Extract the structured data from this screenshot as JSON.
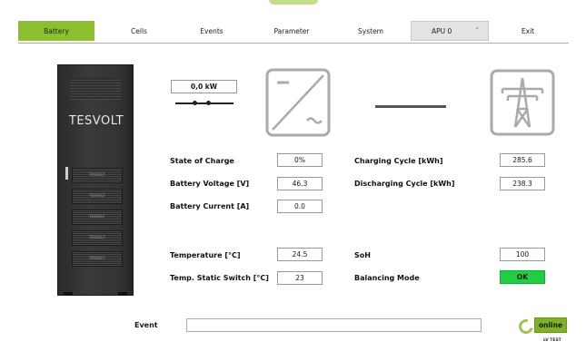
{
  "tabs": {
    "battery": "Battery",
    "cells": "Cells",
    "events": "Events",
    "parameter": "Parameter",
    "system": "System",
    "apu": "APU 0",
    "exit": "Exit"
  },
  "cabinet": {
    "logo": "TESVOLT",
    "module_label": "TESVOLT"
  },
  "power": {
    "value": "0,0 kW"
  },
  "metrics": {
    "state_of_charge": {
      "label": "State of Charge",
      "value": "0%"
    },
    "battery_voltage": {
      "label": "Battery Voltage [V]",
      "value": "46.3"
    },
    "battery_current": {
      "label": "Battery Current [A]",
      "value": "0.0"
    },
    "temperature": {
      "label": "Temperature [°C]",
      "value": "24.5"
    },
    "temp_static_switch": {
      "label": "Temp. Static Switch [°C]",
      "value": "23"
    },
    "charging_cycle": {
      "label": "Charging Cycle [kWh]",
      "value": "285.6"
    },
    "discharging_cycle": {
      "label": "Discharging Cycle [kWh]",
      "value": "238.3"
    },
    "soh": {
      "label": "SoH",
      "value": "100"
    },
    "balancing_mode": {
      "label": "Balancing Mode",
      "value": "OK"
    }
  },
  "event": {
    "label": "Event",
    "value": ""
  },
  "status": {
    "online": "online",
    "mode": "LV TEST"
  },
  "colors": {
    "accent": "#8cbf2f",
    "ok": "#22cc44"
  },
  "icons": {
    "inverter": "inverter-icon",
    "grid": "power-grid-icon",
    "dropdown": "chevron-down-icon"
  }
}
